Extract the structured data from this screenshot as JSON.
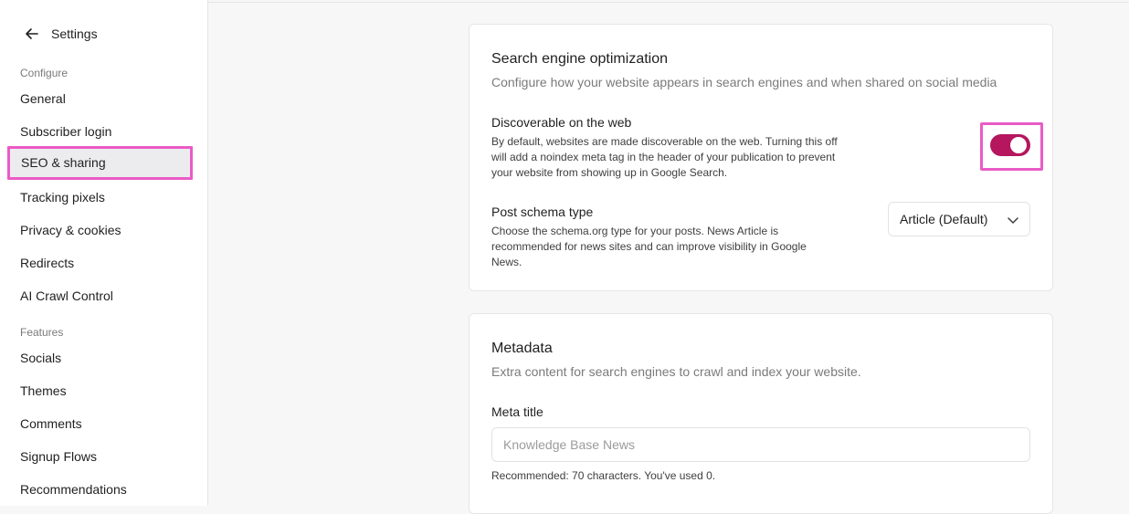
{
  "sidebar": {
    "back_label": "Settings",
    "configure_label": "Configure",
    "configure_items": [
      "General",
      "Subscriber login",
      "SEO & sharing",
      "Tracking pixels",
      "Privacy & cookies",
      "Redirects",
      "AI Crawl Control"
    ],
    "features_label": "Features",
    "features_items": [
      "Socials",
      "Themes",
      "Comments",
      "Signup Flows",
      "Recommendations"
    ],
    "active_item": "SEO & sharing"
  },
  "seo": {
    "title": "Search engine optimization",
    "description": "Configure how your website appears in search engines and when shared on social media",
    "discoverable": {
      "title": "Discoverable on the web",
      "help": "By default, websites are made discoverable on the web. Turning this off will add a noindex meta tag in the header of your publication to prevent your website from showing up in Google Search.",
      "enabled": true
    },
    "schema": {
      "title": "Post schema type",
      "help": "Choose the schema.org type for your posts. News Article is recommended for news sites and can improve visibility in Google News.",
      "selected": "Article (Default)"
    }
  },
  "metadata": {
    "title": "Metadata",
    "description": "Extra content for search engines to crawl and index your website.",
    "meta_title_label": "Meta title",
    "meta_title_value": "",
    "meta_title_placeholder": "Knowledge Base News",
    "meta_title_hint": "Recommended: 70 characters. You've used 0."
  },
  "colors": {
    "accent": "#b5165e",
    "highlight": "#ea5bc6"
  }
}
